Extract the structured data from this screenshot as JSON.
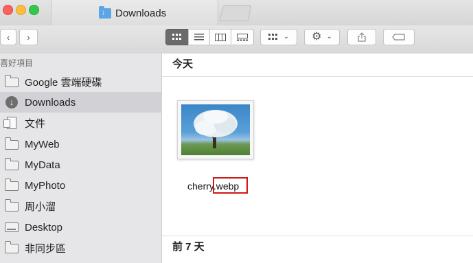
{
  "window": {
    "title": "Downloads"
  },
  "sidebar": {
    "section_label": "喜好項目",
    "items": [
      {
        "label": "Google 雲端硬碟",
        "icon": "folder-icon"
      },
      {
        "label": "Downloads",
        "icon": "download-circle-icon",
        "selected": true
      },
      {
        "label": "文件",
        "icon": "documents-icon"
      },
      {
        "label": "MyWeb",
        "icon": "folder-icon"
      },
      {
        "label": "MyData",
        "icon": "folder-icon"
      },
      {
        "label": "MyPhoto",
        "icon": "folder-icon"
      },
      {
        "label": "周小溜",
        "icon": "folder-icon"
      },
      {
        "label": "Desktop",
        "icon": "desktop-icon"
      },
      {
        "label": "非同步區",
        "icon": "folder-icon"
      }
    ]
  },
  "toolbar": {
    "view_modes": [
      "icon-view-icon",
      "list-view-icon",
      "column-view-icon",
      "gallery-view-icon"
    ],
    "selected_view": "icon-view-icon"
  },
  "main": {
    "sections": [
      {
        "title": "今天"
      },
      {
        "title": "前 7 天"
      }
    ],
    "file": {
      "name_stem": "cherry",
      "name_ext": ".webp"
    }
  },
  "colors": {
    "selected_row": "#d2d2d6",
    "highlight_box": "#d01616",
    "folder_accent": "#5aa6e6"
  }
}
